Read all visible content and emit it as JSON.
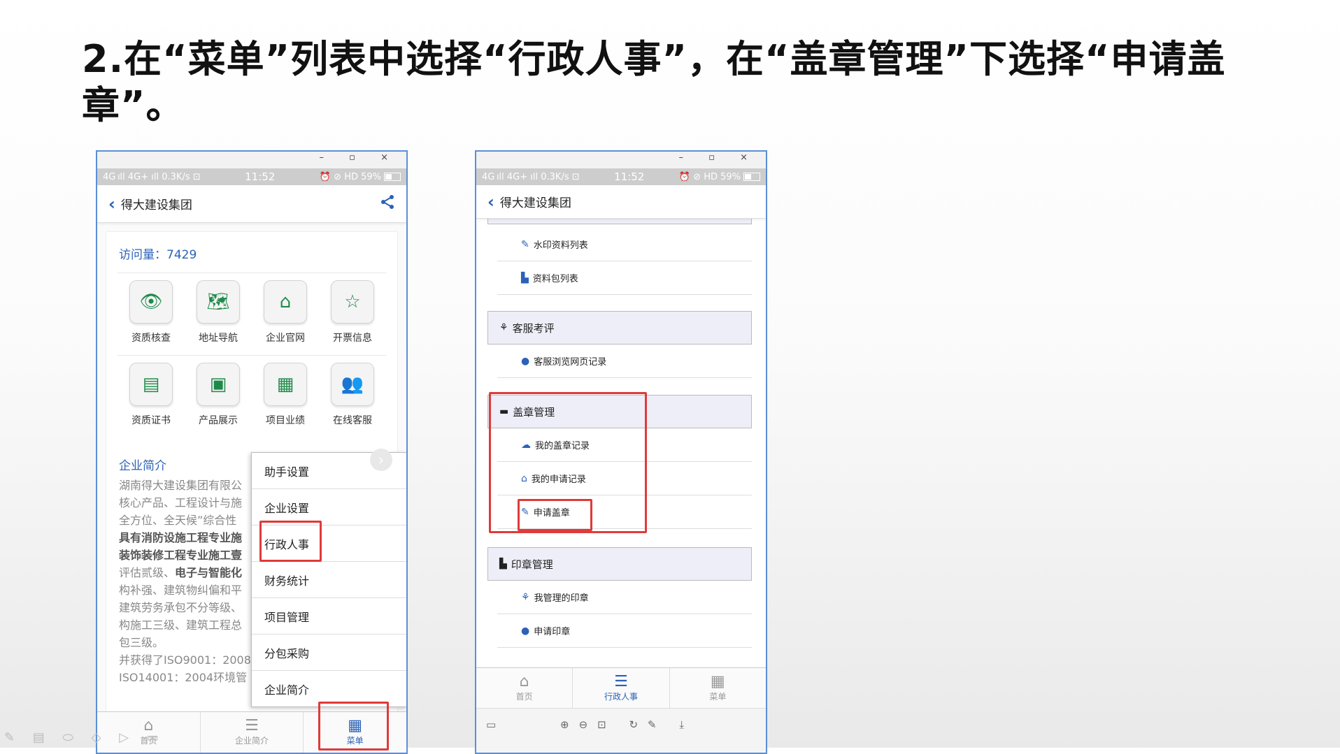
{
  "slide": {
    "title": "2.在“菜单”列表中选择“行政人事”，在“盖章管理”下选择“申请盖章”。"
  },
  "window": {
    "controls": "–  ▫  ×"
  },
  "status": {
    "signal": "4G ıll 4G+ ıll 0.3K/s ⊡",
    "time": "11:52",
    "right": "⏰ ⊘ HD 59%"
  },
  "app": {
    "title": "得大建设集团"
  },
  "left_phone": {
    "visits": "访问量：7429",
    "grid": [
      [
        {
          "label": "资质核查",
          "icon": "👁"
        },
        {
          "label": "地址导航",
          "icon": "🗺"
        },
        {
          "label": "企业官网",
          "icon": "⌂"
        },
        {
          "label": "开票信息",
          "icon": "☆"
        }
      ],
      [
        {
          "label": "资质证书",
          "icon": "▤"
        },
        {
          "label": "产品展示",
          "icon": "▣"
        },
        {
          "label": "项目业绩",
          "icon": "▦"
        },
        {
          "label": "在线客服",
          "icon": "👥"
        }
      ]
    ],
    "intro_title": "企业简介",
    "intro_para1": "湖南得大建设集团有限公\n核心产品、工程设计与施\n全方位、全天候”综合性",
    "intro_para2_bold1": "具有消防设施工程专业施",
    "intro_para2_bold2": "装饰装修工程专业施工壹",
    "intro_para2_rest1": "评估贰级、",
    "intro_para2_bold3": "电子与智能化",
    "intro_para2_rest2": "构补强、建筑物纠偏和平\n建筑劳务承包不分等级、\n构施工三级、建筑工程总\n包三级。",
    "intro_para3": "并获得了ISO9001：2008\nISO14001：2004环境管",
    "popup_menu": [
      "助手设置",
      "企业设置",
      "行政人事",
      "财务统计",
      "项目管理",
      "分包采购",
      "企业简介"
    ],
    "tabs": [
      {
        "label": "首页",
        "icon": "⌂"
      },
      {
        "label": "企业简介",
        "icon": "☰"
      },
      {
        "label": "菜单",
        "icon": "▦"
      }
    ]
  },
  "right_phone": {
    "items_top": [
      {
        "label": "水印资料列表",
        "icon": "✎"
      },
      {
        "label": "资料包列表",
        "icon": "▙"
      }
    ],
    "section_kefu": {
      "label": "客服考评",
      "icon": "⚘"
    },
    "kefu_items": [
      {
        "label": "客服浏览网页记录",
        "icon": "●"
      }
    ],
    "section_gaizhang": {
      "label": "盖章管理",
      "icon": "▬"
    },
    "gaizhang_items": [
      {
        "label": "我的盖章记录",
        "icon": "☁"
      },
      {
        "label": "我的申请记录",
        "icon": "⌂"
      },
      {
        "label": "申请盖章",
        "icon": "✎"
      }
    ],
    "section_yinzhang": {
      "label": "印章管理",
      "icon": "▙"
    },
    "yinzhang_items": [
      {
        "label": "我管理的印章",
        "icon": "⚘"
      },
      {
        "label": "申请印章",
        "icon": "●"
      }
    ],
    "tabs": [
      {
        "label": "首页",
        "icon": "⌂"
      },
      {
        "label": "行政人事",
        "icon": "☰"
      },
      {
        "label": "菜单",
        "icon": "▦"
      }
    ],
    "viewer_left": "▭",
    "viewer_tools": "⊕⊖⊡ ↻✎ ⤓"
  },
  "annotation_tools": "✎ ▤ ⬭ ◇ ▷ ▭",
  "colors": {
    "accent": "#2b62b8",
    "highlight": "#e03a3a",
    "icon_green": "#1e8a4a"
  }
}
